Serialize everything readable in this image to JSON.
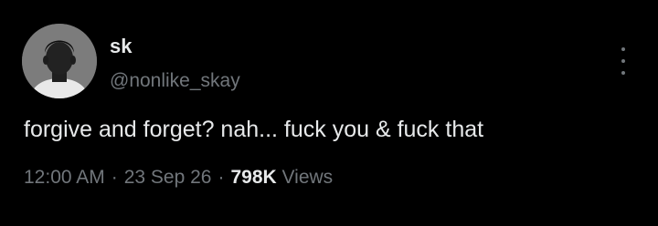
{
  "author": {
    "display_name": "sk",
    "handle": "@nonlike_skay",
    "avatar": "profile-photo"
  },
  "post": {
    "text": "forgive and forget? nah... fuck you & fuck that"
  },
  "meta": {
    "time": "12:00 AM",
    "separator": "·",
    "date": "23 Sep 26",
    "views_count": "798K",
    "views_label": "Views"
  },
  "icons": {
    "more": "more-vertical-icon"
  },
  "colors": {
    "background": "#000000",
    "primary_text": "#e7e9ea",
    "secondary_text": "#71767b"
  }
}
